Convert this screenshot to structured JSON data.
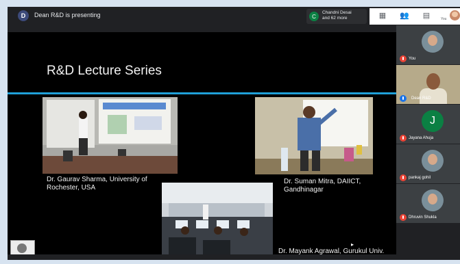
{
  "topbar": {
    "presenter_initial": "D",
    "presenter_label": "Dean R&D is presenting",
    "people_chip": {
      "initial": "C",
      "line1": "Chandni Desai",
      "line2": "and 62 more"
    },
    "toolbar": {
      "you_label": "You"
    }
  },
  "slide": {
    "title": "R&D Lecture Series",
    "captions": [
      {
        "line1": "Dr. Gaurav Sharma, University of",
        "line2": "Rochester, USA"
      },
      {
        "line1": "Dr. Suman Mitra, DAIICT,",
        "line2": "Gandhinagar"
      },
      {
        "line1": "Dr. Mayank Agrawal, Gurukul Univ."
      }
    ]
  },
  "participants": [
    {
      "name": "You",
      "avatar": "photo",
      "mic": "muted"
    },
    {
      "name": "Dean R&D",
      "avatar": "video",
      "mic": "speaking"
    },
    {
      "name": "Jayana Ahuja",
      "initial": "J",
      "avatar": "initial",
      "mic": "muted"
    },
    {
      "name": "pankaj gohil",
      "avatar": "photo",
      "mic": "muted"
    },
    {
      "name": "Dhruvin Shukla",
      "avatar": "photo",
      "mic": "muted"
    }
  ],
  "colors": {
    "accent_rule": "#1fa0d8",
    "muted_mic": "#ea4335",
    "initial_avatar": "#0b8043"
  }
}
